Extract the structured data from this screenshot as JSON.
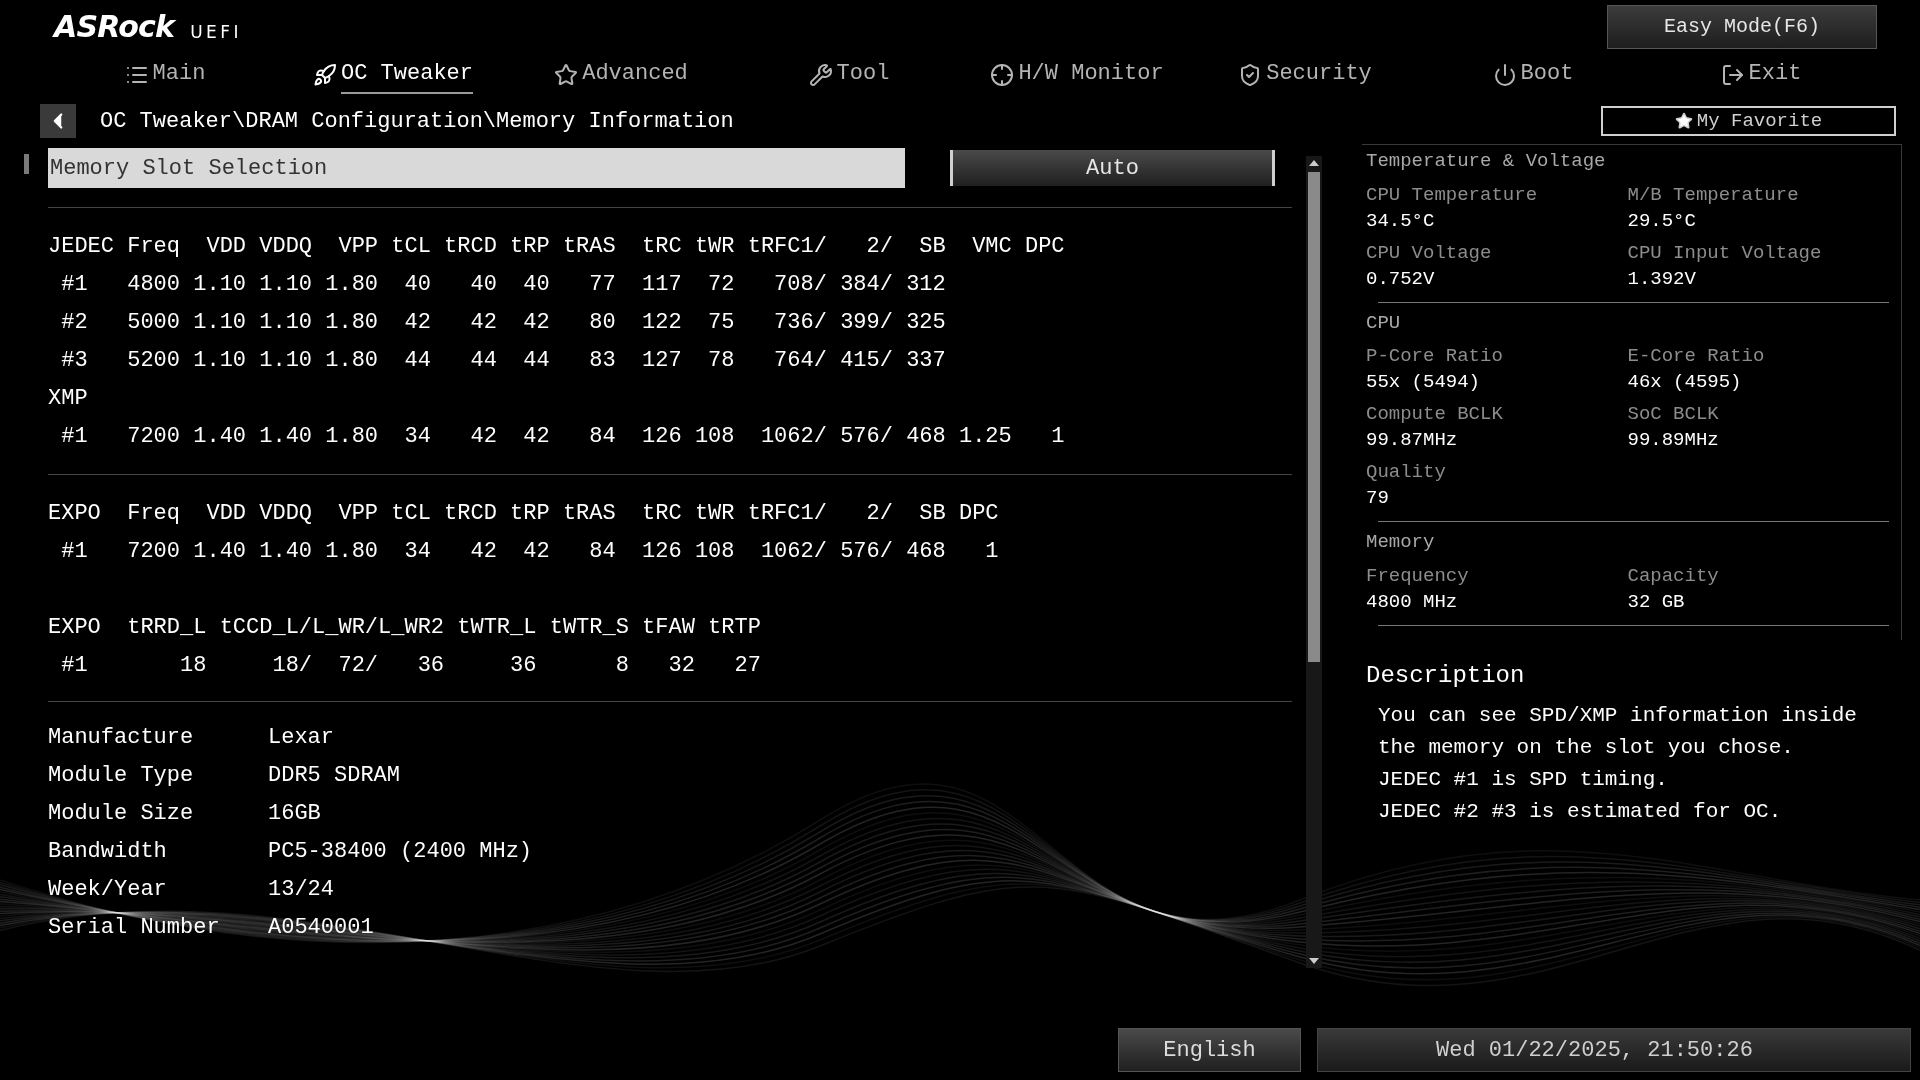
{
  "header": {
    "logo": "ASRock",
    "logo_suffix": "UEFI",
    "easy_mode": "Easy Mode(F6)"
  },
  "tabs": [
    {
      "label": "Main",
      "selected": false
    },
    {
      "label": "OC Tweaker",
      "selected": true
    },
    {
      "label": "Advanced",
      "selected": false
    },
    {
      "label": "Tool",
      "selected": false
    },
    {
      "label": "H/W Monitor",
      "selected": false
    },
    {
      "label": "Security",
      "selected": false
    },
    {
      "label": "Boot",
      "selected": false
    },
    {
      "label": "Exit",
      "selected": false
    }
  ],
  "breadcrumb": "OC Tweaker\\DRAM Configuration\\Memory Information",
  "favorite": "My Favorite",
  "slot_selection": {
    "label": "Memory Slot Selection",
    "value": "Auto"
  },
  "spd_sections": [
    {
      "blocks": [
        {
          "lines": [
            "JEDEC Freq  VDD VDDQ  VPP tCL tRCD tRP tRAS  tRC tWR tRFC1/   2/  SB  VMC DPC",
            " #1   4800 1.10 1.10 1.80  40   40  40   77  117  72   708/ 384/ 312",
            " #2   5000 1.10 1.10 1.80  42   42  42   80  122  75   736/ 399/ 325",
            " #3   5200 1.10 1.10 1.80  44   44  44   83  127  78   764/ 415/ 337",
            "XMP",
            " #1   7200 1.40 1.40 1.80  34   42  42   84  126 108  1062/ 576/ 468 1.25   1"
          ]
        }
      ]
    },
    {
      "blocks": [
        {
          "lines": [
            "EXPO  Freq  VDD VDDQ  VPP tCL tRCD tRP tRAS  tRC tWR tRFC1/   2/  SB DPC",
            " #1   7200 1.40 1.40 1.80  34   42  42   84  126 108  1062/ 576/ 468   1"
          ]
        },
        {
          "lines": [
            "EXPO  tRRD_L tCCD_L/L_WR/L_WR2 tWTR_L tWTR_S tFAW tRTP",
            " #1       18     18/  72/   36     36      8   32   27"
          ]
        }
      ]
    }
  ],
  "module_info": [
    {
      "label": "Manufacture",
      "value": "Lexar"
    },
    {
      "label": "Module Type",
      "value": "DDR5 SDRAM"
    },
    {
      "label": "Module Size",
      "value": "16GB"
    },
    {
      "label": "Bandwidth",
      "value": "PC5-38400 (2400 MHz)"
    },
    {
      "label": "Week/Year",
      "value": "13/24"
    },
    {
      "label": "Serial Number",
      "value": "A0540001"
    }
  ],
  "hw_monitor": [
    {
      "title": "Temperature & Voltage",
      "items": [
        {
          "label": "CPU Temperature",
          "value": "34.5°C"
        },
        {
          "label": "M/B Temperature",
          "value": "29.5°C"
        },
        {
          "label": "CPU Voltage",
          "value": "0.752V"
        },
        {
          "label": "CPU Input Voltage",
          "value": "1.392V"
        }
      ]
    },
    {
      "title": "CPU",
      "items": [
        {
          "label": "P-Core Ratio",
          "value": "55x (5494)"
        },
        {
          "label": "E-Core Ratio",
          "value": "46x (4595)"
        },
        {
          "label": "Compute BCLK",
          "value": "99.87MHz"
        },
        {
          "label": "SoC BCLK",
          "value": "99.89MHz"
        },
        {
          "label": "Quality",
          "value": "79"
        }
      ]
    },
    {
      "title": "Memory",
      "items": [
        {
          "label": "Frequency",
          "value": "4800 MHz"
        },
        {
          "label": "Capacity",
          "value": "32 GB"
        }
      ]
    }
  ],
  "description": {
    "title": "Description",
    "lines": [
      "You can see SPD/XMP information inside",
      "the memory on the slot you chose.",
      "JEDEC #1 is SPD timing.",
      "JEDEC #2 #3 is estimated for OC."
    ]
  },
  "footer": {
    "language": "English",
    "datetime": "Wed 01/22/2025, 21:50:26"
  }
}
